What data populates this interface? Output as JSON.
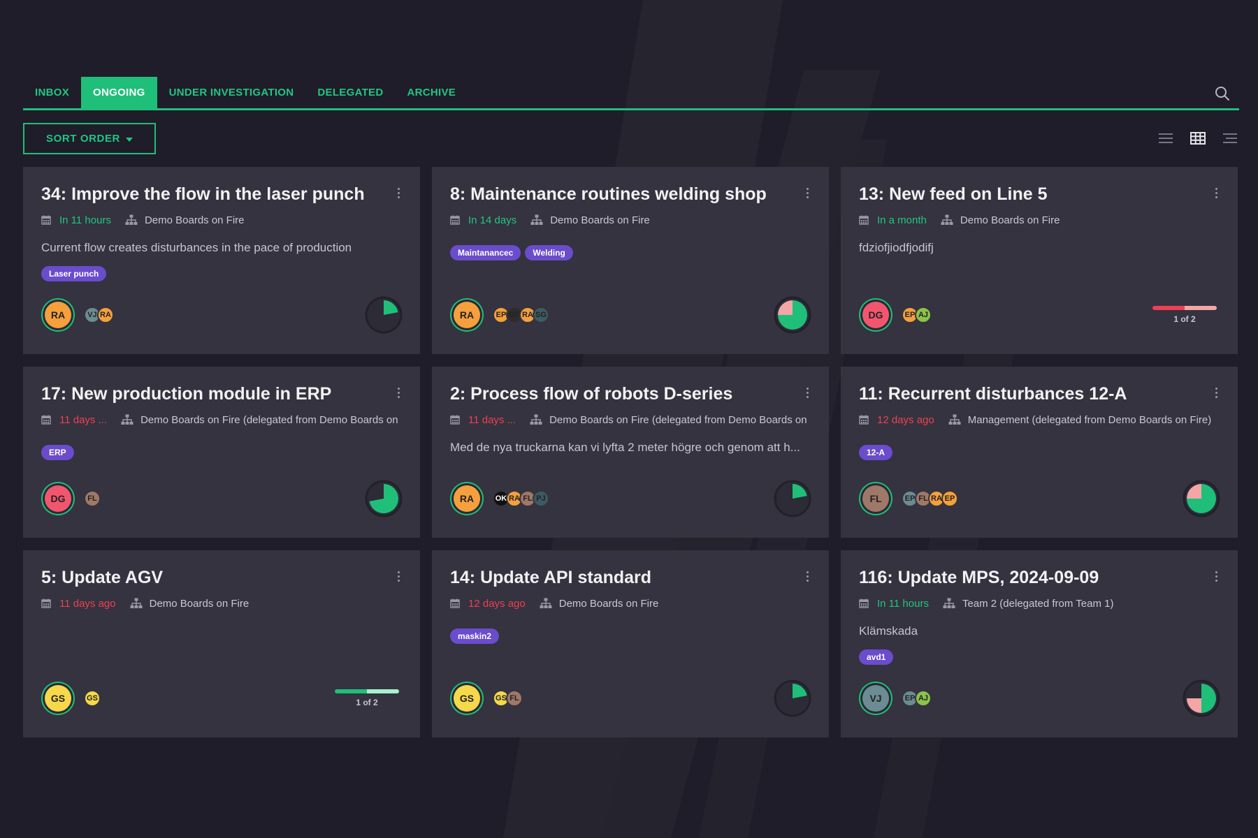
{
  "tabs": [
    {
      "label": "INBOX",
      "active": false
    },
    {
      "label": "ONGOING",
      "active": true
    },
    {
      "label": "UNDER INVESTIGATION",
      "active": false
    },
    {
      "label": "DELEGATED",
      "active": false
    },
    {
      "label": "ARCHIVE",
      "active": false
    }
  ],
  "toolbar": {
    "sort_label": "SORT ORDER",
    "search_icon": "search-icon",
    "view_icons": [
      "list-view-icon",
      "grid-view-icon",
      "compact-view-icon"
    ]
  },
  "colors": {
    "accent": "#1fbf7a",
    "due_soon": "#22c583",
    "overdue": "#ef3f55",
    "tag": "#6a4ccc",
    "card": "#34333f",
    "background": "#1e1d29"
  },
  "cards": [
    {
      "title": "34: Improve the flow in the laser punch",
      "due": "In 11 hours",
      "due_status": "green",
      "board": "Demo Boards on Fire",
      "description": "Current flow creates disturbances in the pace of production",
      "tags": [
        "Laser punch"
      ],
      "owner": {
        "initials": "RA",
        "color": "#f5a03c"
      },
      "members": [
        {
          "initials": "VJ",
          "color": "#6b8c92"
        },
        {
          "initials": "RA",
          "color": "#f5a03c"
        }
      ],
      "progress": {
        "type": "pie",
        "value": 0.22
      }
    },
    {
      "title": "8: Maintenance routines welding shop",
      "due": "In 14 days",
      "due_status": "green",
      "board": "Demo Boards on Fire",
      "description": "",
      "tags": [
        "Maintanancec",
        "Welding"
      ],
      "owner": {
        "initials": "RA",
        "color": "#f5a03c"
      },
      "members": [
        {
          "initials": "EP",
          "color": "#f5a03c"
        },
        {
          "initials": "GF",
          "color": "#2c2c2c"
        },
        {
          "initials": "RA",
          "color": "#f5a03c"
        },
        {
          "initials": "SG",
          "color": "#3c5b62"
        }
      ],
      "progress": {
        "type": "pie",
        "value": 0.75,
        "remainder_color": "#f4a6a6"
      }
    },
    {
      "title": "13: New feed on Line 5",
      "due": "In a month",
      "due_status": "green",
      "board": "Demo Boards on Fire",
      "description": "fdziofjiodfjodifj",
      "tags": [],
      "owner": {
        "initials": "DG",
        "color": "#f2566e"
      },
      "members": [
        {
          "initials": "EP",
          "color": "#f5a03c"
        },
        {
          "initials": "AJ",
          "color": "#8bc34a"
        }
      ],
      "progress": {
        "type": "bar",
        "value": 0.5,
        "label": "1 of 2",
        "done_color": "#ef3f55",
        "rest_color": "#f4a6a6"
      }
    },
    {
      "title": "17: New production module in ERP",
      "due": "11 days ...",
      "due_status": "red",
      "board": "Demo Boards on Fire (delegated from Demo Boards on",
      "description": "",
      "tags": [
        "ERP"
      ],
      "owner": {
        "initials": "DG",
        "color": "#f2566e"
      },
      "members": [
        {
          "initials": "FL",
          "color": "#a07868"
        }
      ],
      "progress": {
        "type": "pie",
        "value": 0.72
      }
    },
    {
      "title": "2: Process flow of robots D-series",
      "due": "11 days ...",
      "due_status": "red",
      "board": "Demo Boards on Fire (delegated from Demo Boards on",
      "description": "Med de nya truckarna kan vi lyfta 2 meter högre och genom att h...",
      "tags": [],
      "owner": {
        "initials": "RA",
        "color": "#f5a03c"
      },
      "members": [
        {
          "initials": "OK",
          "color": "#111111",
          "text_color": "#ffffff"
        },
        {
          "initials": "RA",
          "color": "#f5a03c"
        },
        {
          "initials": "FL",
          "color": "#a07868"
        },
        {
          "initials": "PJ",
          "color": "#3c5b62"
        }
      ],
      "progress": {
        "type": "pie",
        "value": 0.22
      }
    },
    {
      "title": "11: Recurrent disturbances 12-A",
      "due": "12 days ago",
      "due_status": "red",
      "board": "Management (delegated from Demo Boards on Fire)",
      "description": "",
      "tags": [
        "12-A"
      ],
      "owner": {
        "initials": "FL",
        "color": "#a07868"
      },
      "members": [
        {
          "initials": "EP",
          "color": "#6b8c92"
        },
        {
          "initials": "FL",
          "color": "#a07868"
        },
        {
          "initials": "RA",
          "color": "#f5a03c"
        },
        {
          "initials": "EP",
          "color": "#f5a03c"
        }
      ],
      "progress": {
        "type": "pie",
        "value": 0.75,
        "remainder_color": "#f4a6a6"
      }
    },
    {
      "title": "5: Update AGV",
      "due": "11 days ago",
      "due_status": "red",
      "board": "Demo Boards on Fire",
      "description": "",
      "tags": [],
      "owner": {
        "initials": "GS",
        "color": "#f6d84a"
      },
      "members": [
        {
          "initials": "GS",
          "color": "#f6d84a"
        }
      ],
      "progress": {
        "type": "bar",
        "value": 0.5,
        "label": "1 of 2",
        "done_color": "#1fbf7a",
        "rest_color": "#a8f0d0"
      }
    },
    {
      "title": "14: Update API standard",
      "due": "12 days ago",
      "due_status": "red",
      "board": "Demo Boards on Fire",
      "description": "",
      "tags": [
        "maskin2"
      ],
      "owner": {
        "initials": "GS",
        "color": "#f6d84a"
      },
      "members": [
        {
          "initials": "GS",
          "color": "#f6d84a"
        },
        {
          "initials": "FL",
          "color": "#a07868"
        }
      ],
      "progress": {
        "type": "pie",
        "value": 0.22
      }
    },
    {
      "title": "116: Update MPS, 2024-09-09",
      "due": "In 11 hours",
      "due_status": "green",
      "board": "Team 2 (delegated from Team 1)",
      "description": "Klämskada",
      "tags": [
        "avd1"
      ],
      "owner": {
        "initials": "VJ",
        "color": "#6b8c92"
      },
      "members": [
        {
          "initials": "EP",
          "color": "#6b8c92"
        },
        {
          "initials": "AJ",
          "color": "#8bc34a"
        }
      ],
      "progress": {
        "type": "pie",
        "value": 0.5,
        "remainder_color": "#f4a6a6",
        "remainder_value": 0.25
      }
    }
  ]
}
